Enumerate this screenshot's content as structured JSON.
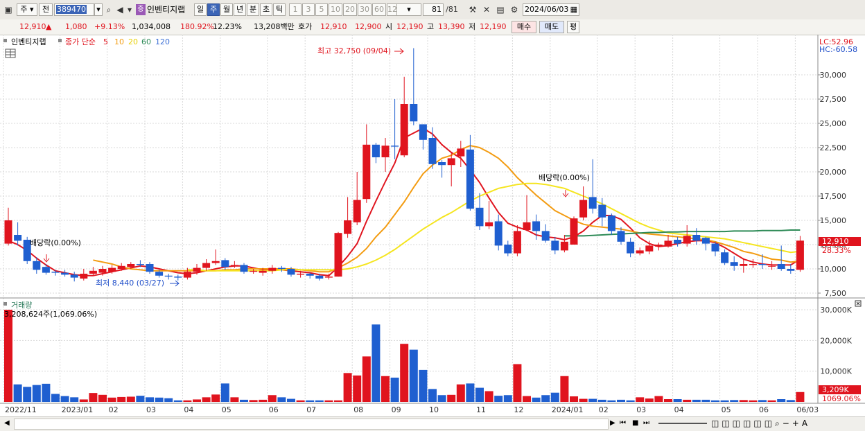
{
  "toolbar": {
    "type_select": "주",
    "prev_label": "전",
    "stock_code": "389470",
    "stock_name": "인벤티지랩",
    "period_tabs": [
      "일",
      "주",
      "월",
      "년",
      "분",
      "초",
      "틱"
    ],
    "active_period": "주",
    "intervals": [
      "1",
      "3",
      "5",
      "10",
      "20",
      "30",
      "60",
      "120"
    ],
    "count_current": "81",
    "count_total": "/81",
    "date": "2024/06/03"
  },
  "quote": {
    "price": "12,910",
    "change": "1,080",
    "change_pct": "+9.13%",
    "volume": "1,034,008",
    "volume_ratio": "180.92%",
    "turnover": "12.23%",
    "amount": "13,208백만",
    "ask_label": "호가",
    "ask": "12,910",
    "bid": "12,900",
    "open_label": "시",
    "open": "12,190",
    "high_label": "고",
    "high": "13,390",
    "low_label": "저",
    "low": "12,190",
    "buy_label": "매수",
    "sell_label": "매도",
    "extra_label": "평"
  },
  "legend": {
    "stock_name": "인벤티지랩",
    "ma_title": "종가 단순",
    "ma_periods": [
      {
        "label": "5",
        "color": "#e0141e"
      },
      {
        "label": "10",
        "color": "#f39c12"
      },
      {
        "label": "20",
        "color": "#f2e21a"
      },
      {
        "label": "60",
        "color": "#2e8b57"
      },
      {
        "label": "120",
        "color": "#3b6fd6"
      }
    ],
    "volume_title": "거래량",
    "volume_info": "3,208,624주(1,069.06%)"
  },
  "annotations": {
    "high": "최고 32,750 (09/04)",
    "low": "최저 8,440 (03/27)",
    "ex_div_1": "배당락(0.00%)",
    "ex_div_2": "배당락(0.00%)"
  },
  "side": {
    "lc": "LC:52.96",
    "hc": "HC:-60.58",
    "price_tag": "12,910",
    "pct_tag": "28.33%",
    "vol_tag": "3,209K",
    "vol_pct_tag": "1069.06%"
  },
  "chart_data": {
    "type": "candlestick",
    "price_axis": {
      "min": 7500,
      "max": 30000,
      "ticks": [
        "7,500",
        "10,000",
        "12,500",
        "15,000",
        "17,500",
        "20,000",
        "22,500",
        "25,000",
        "27,500",
        "30,000"
      ]
    },
    "volume_axis": {
      "ticks": [
        "10,000K",
        "20,000K",
        "30,000K"
      ]
    },
    "x_labels": [
      {
        "label": "2022/11",
        "i": 0
      },
      {
        "label": "2023/01",
        "i": 6
      },
      {
        "label": "02",
        "i": 11
      },
      {
        "label": "03",
        "i": 15
      },
      {
        "label": "04",
        "i": 19
      },
      {
        "label": "05",
        "i": 23
      },
      {
        "label": "06",
        "i": 28
      },
      {
        "label": "07",
        "i": 32
      },
      {
        "label": "08",
        "i": 37
      },
      {
        "label": "09",
        "i": 41
      },
      {
        "label": "10",
        "i": 45
      },
      {
        "label": "11",
        "i": 50
      },
      {
        "label": "12",
        "i": 54
      },
      {
        "label": "2024/01",
        "i": 58
      },
      {
        "label": "02",
        "i": 63
      },
      {
        "label": "03",
        "i": 67
      },
      {
        "label": "04",
        "i": 71
      },
      {
        "label": "05",
        "i": 76
      },
      {
        "label": "06",
        "i": 80
      },
      {
        "label": "06/03",
        "i": 84
      }
    ],
    "candles": [
      [
        12600,
        15000,
        16300,
        12400
      ],
      [
        13500,
        12900,
        14800,
        12400
      ],
      [
        13000,
        10800,
        13300,
        10500
      ],
      [
        10800,
        9900,
        11200,
        9500
      ],
      [
        10200,
        9600,
        10500,
        9400
      ],
      [
        9700,
        9600,
        9900,
        9300
      ],
      [
        9600,
        9400,
        9900,
        9200
      ],
      [
        9400,
        9100,
        9700,
        8700
      ],
      [
        9000,
        9500,
        10000,
        8800
      ],
      [
        9500,
        9800,
        10200,
        9300
      ],
      [
        9600,
        10000,
        10300,
        9300
      ],
      [
        9700,
        10100,
        10400,
        9500
      ],
      [
        10000,
        10300,
        10600,
        9800
      ],
      [
        10200,
        10500,
        10700,
        10000
      ],
      [
        10500,
        10400,
        10900,
        10200
      ],
      [
        10500,
        9700,
        10700,
        9500
      ],
      [
        9700,
        9300,
        9900,
        9100
      ],
      [
        9300,
        9200,
        9500,
        8900
      ],
      [
        9200,
        9100,
        9400,
        8800
      ],
      [
        9100,
        9700,
        10100,
        8900
      ],
      [
        9700,
        10100,
        10500,
        9400
      ],
      [
        10100,
        10600,
        11000,
        9800
      ],
      [
        10600,
        10800,
        12000,
        10400
      ],
      [
        10900,
        10200,
        11100,
        9900
      ],
      [
        10300,
        10400,
        10800,
        10100
      ],
      [
        10400,
        9700,
        10600,
        9500
      ],
      [
        9700,
        9800,
        10000,
        9500
      ],
      [
        9600,
        9800,
        10100,
        9300
      ],
      [
        9800,
        10100,
        10400,
        9500
      ],
      [
        10100,
        10000,
        10300,
        9700
      ],
      [
        10000,
        9400,
        10200,
        9200
      ],
      [
        9400,
        9500,
        9800,
        9100
      ],
      [
        9500,
        9300,
        9600,
        9000
      ],
      [
        9300,
        9000,
        9500,
        8800
      ],
      [
        9100,
        9200,
        9500,
        8900
      ],
      [
        9200,
        13700,
        13800,
        9200
      ],
      [
        13600,
        15000,
        17400,
        13200
      ],
      [
        14800,
        17100,
        20000,
        14500
      ],
      [
        17200,
        22800,
        24900,
        16800
      ],
      [
        22800,
        21500,
        23000,
        20900
      ],
      [
        21500,
        22700,
        23500,
        20000
      ],
      [
        22700,
        22600,
        27500,
        21300
      ],
      [
        21700,
        27000,
        29800,
        21500
      ],
      [
        27000,
        25200,
        32750,
        24800
      ],
      [
        24900,
        23300,
        24900,
        22300
      ],
      [
        23500,
        20800,
        24600,
        20300
      ],
      [
        21000,
        20700,
        21200,
        19400
      ],
      [
        20700,
        21400,
        22000,
        18500
      ],
      [
        21600,
        22400,
        23200,
        20500
      ],
      [
        22300,
        16200,
        23800,
        16000
      ],
      [
        16300,
        14400,
        17800,
        14000
      ],
      [
        14400,
        14800,
        17000,
        14100
      ],
      [
        14900,
        12400,
        15600,
        11900
      ],
      [
        12500,
        11600,
        12900,
        11300
      ],
      [
        11600,
        13900,
        14500,
        11300
      ],
      [
        14000,
        14800,
        17600,
        13900
      ],
      [
        14900,
        13900,
        15600,
        13000
      ],
      [
        13900,
        12900,
        14600,
        12700
      ],
      [
        12900,
        11900,
        13300,
        11500
      ],
      [
        11900,
        12800,
        13500,
        11700
      ],
      [
        12500,
        15200,
        15400,
        12500
      ],
      [
        15300,
        17100,
        18500,
        15000
      ],
      [
        17400,
        16200,
        21300,
        15700
      ],
      [
        16600,
        15300,
        17300,
        14400
      ],
      [
        15500,
        13900,
        15700,
        13500
      ],
      [
        13900,
        12800,
        14300,
        12500
      ],
      [
        12800,
        11600,
        13200,
        11200
      ],
      [
        11600,
        11900,
        12200,
        11400
      ],
      [
        11800,
        12400,
        12900,
        11500
      ],
      [
        12300,
        12500,
        12700,
        11900
      ],
      [
        12300,
        12900,
        13500,
        12200
      ],
      [
        13000,
        12600,
        13300,
        12300
      ],
      [
        12600,
        13400,
        14500,
        12300
      ],
      [
        13500,
        12900,
        14200,
        12500
      ],
      [
        13200,
        12600,
        13300,
        11900
      ],
      [
        12600,
        11800,
        12800,
        11300
      ],
      [
        11700,
        10600,
        12000,
        10400
      ],
      [
        10700,
        10300,
        11300,
        9800
      ],
      [
        10300,
        10500,
        11100,
        9600
      ],
      [
        10400,
        10500,
        11000,
        10100
      ],
      [
        10500,
        10400,
        11500,
        10000
      ],
      [
        10300,
        10300,
        10800,
        9900
      ],
      [
        10500,
        10000,
        12400,
        9800
      ],
      [
        10000,
        9800,
        10500,
        9500
      ],
      [
        9900,
        12910,
        13390,
        9700
      ]
    ],
    "volumes": [
      31000,
      5700,
      4900,
      5500,
      5900,
      2600,
      1900,
      1500,
      800,
      2900,
      2300,
      1400,
      1600,
      1700,
      2000,
      1500,
      1400,
      1200,
      500,
      500,
      800,
      1500,
      2400,
      6000,
      1500,
      700,
      600,
      700,
      2200,
      1500,
      1000,
      500,
      500,
      500,
      500,
      500,
      9400,
      8600,
      14800,
      25200,
      8400,
      7900,
      18900,
      17000,
      10400,
      4200,
      2200,
      2300,
      5700,
      6000,
      4600,
      3500,
      2000,
      2200,
      12300,
      1900,
      1400,
      2200,
      3000,
      8400,
      1800,
      1000,
      1000,
      700,
      500,
      700,
      500,
      1500,
      1100,
      1900,
      900,
      900,
      700,
      700,
      700,
      500,
      500,
      600,
      600,
      500,
      600,
      500,
      900,
      600,
      3209
    ],
    "ma_lines": {
      "ma5": [
        12900,
        12500,
        11900,
        11100,
        10400,
        9800,
        9600,
        9400,
        9300,
        9300,
        9500,
        9700,
        9900,
        10100,
        10300,
        10200,
        10000,
        9800,
        9600,
        9500,
        9600,
        9800,
        10000,
        10200,
        10300,
        10300,
        10100,
        9900,
        9900,
        9900,
        9800,
        9700,
        9600,
        9400,
        9300,
        10200,
        11300,
        12600,
        14900,
        17000,
        19000,
        20900,
        23500,
        24000,
        24500,
        23900,
        22800,
        22000,
        21400,
        20200,
        18900,
        17300,
        15800,
        14700,
        14300,
        14000,
        13500,
        13300,
        13200,
        13000,
        13300,
        13900,
        14800,
        15500,
        15500,
        15100,
        14200,
        13200,
        12600,
        12300,
        12400,
        12600,
        12800,
        12900,
        12900,
        12700,
        12200,
        11600,
        11000,
        10700,
        10500,
        10400,
        10400,
        10400,
        11000
      ],
      "ma10": [
        null,
        null,
        null,
        null,
        null,
        null,
        null,
        null,
        null,
        10900,
        10700,
        10500,
        10200,
        10000,
        9900,
        9800,
        9800,
        9800,
        9800,
        9800,
        9800,
        9800,
        9800,
        9900,
        9900,
        10000,
        10000,
        10000,
        10000,
        10000,
        10000,
        9900,
        9800,
        9700,
        9700,
        10100,
        10600,
        11200,
        12100,
        13300,
        14300,
        15600,
        16900,
        18400,
        19800,
        20700,
        21400,
        21700,
        22300,
        22700,
        22500,
        22000,
        21400,
        20500,
        19400,
        18500,
        17600,
        16800,
        16000,
        15500,
        15000,
        14600,
        14400,
        14300,
        14200,
        14100,
        13900,
        13700,
        13600,
        13500,
        13400,
        13300,
        13200,
        13100,
        13000,
        12800,
        12500,
        12200,
        11800,
        11600,
        11300,
        11000,
        10900,
        10700,
        10800
      ],
      "ma20": [
        null,
        null,
        null,
        null,
        null,
        null,
        null,
        null,
        null,
        null,
        null,
        null,
        null,
        null,
        null,
        null,
        null,
        null,
        null,
        9900,
        9900,
        9800,
        9800,
        9800,
        9800,
        9800,
        9800,
        9800,
        9800,
        9900,
        9900,
        9900,
        9900,
        9900,
        9900,
        9900,
        10000,
        10200,
        10500,
        10900,
        11400,
        12000,
        12700,
        13400,
        14100,
        14700,
        15300,
        15800,
        16400,
        17000,
        17500,
        17900,
        18300,
        18500,
        18700,
        18800,
        18800,
        18700,
        18500,
        18300,
        17900,
        17500,
        17100,
        16700,
        16200,
        15700,
        15200,
        14700,
        14300,
        14000,
        13700,
        13600,
        13500,
        13400,
        13300,
        13200,
        13100,
        12900,
        12700,
        12500,
        12300,
        12100,
        11900,
        11700,
        11800
      ],
      "ma60": [
        null,
        null,
        null,
        null,
        null,
        null,
        null,
        null,
        null,
        null,
        null,
        null,
        null,
        null,
        null,
        null,
        null,
        null,
        null,
        null,
        null,
        null,
        null,
        null,
        null,
        null,
        null,
        null,
        null,
        null,
        null,
        null,
        null,
        null,
        null,
        null,
        null,
        null,
        null,
        null,
        null,
        null,
        null,
        null,
        null,
        null,
        null,
        null,
        null,
        null,
        null,
        null,
        null,
        null,
        null,
        null,
        null,
        null,
        null,
        13400,
        13400,
        13400,
        13450,
        13500,
        13550,
        13600,
        13650,
        13700,
        13750,
        13750,
        13800,
        13800,
        13850,
        13850,
        13850,
        13850,
        13850,
        13900,
        13900,
        13900,
        13950,
        13950,
        13950,
        14000,
        14000
      ]
    }
  }
}
